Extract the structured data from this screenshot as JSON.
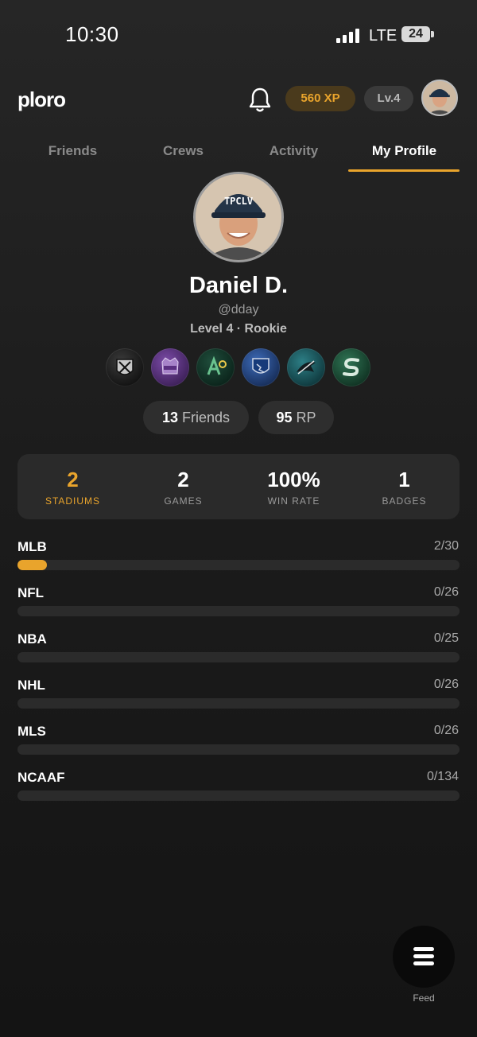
{
  "status_bar": {
    "time": "10:30",
    "network": "LTE",
    "battery": "24"
  },
  "header": {
    "logo": "ploro",
    "xp": "560 XP",
    "level": "Lv.4",
    "icons": [
      "bell-icon",
      "avatar"
    ]
  },
  "tabs": [
    {
      "label": "Friends",
      "active": false
    },
    {
      "label": "Crews",
      "active": false
    },
    {
      "label": "Activity",
      "active": false
    },
    {
      "label": "My Profile",
      "active": true
    }
  ],
  "profile": {
    "name": "Daniel D.",
    "handle": "@dday",
    "level": "Level 4 · Rookie",
    "teams": [
      "raiders-logo",
      "kings-logo",
      "athletics-logo",
      "earthquakes-logo",
      "sharks-logo",
      "sacramento-state-logo"
    ],
    "friends_count": "13",
    "friends_label": "Friends",
    "rp_count": "95",
    "rp_label": "RP"
  },
  "stats": [
    {
      "value": "2",
      "label": "STADIUMS",
      "highlight": true
    },
    {
      "value": "2",
      "label": "GAMES",
      "highlight": false
    },
    {
      "value": "100%",
      "label": "WIN RATE",
      "highlight": false
    },
    {
      "value": "1",
      "label": "BADGES",
      "highlight": false
    }
  ],
  "leagues": [
    {
      "name": "MLB",
      "count": "2/30",
      "progress": 0.0667
    },
    {
      "name": "NFL",
      "count": "0/26",
      "progress": 0
    },
    {
      "name": "NBA",
      "count": "0/25",
      "progress": 0
    },
    {
      "name": "NHL",
      "count": "0/26",
      "progress": 0
    },
    {
      "name": "MLS",
      "count": "0/26",
      "progress": 0
    },
    {
      "name": "NCAAF",
      "count": "0/134",
      "progress": 0
    }
  ],
  "fab": {
    "label": "Feed"
  },
  "colors": {
    "accent": "#e9a42c",
    "background": "#1c1c1c",
    "card": "#2a2a2a"
  }
}
